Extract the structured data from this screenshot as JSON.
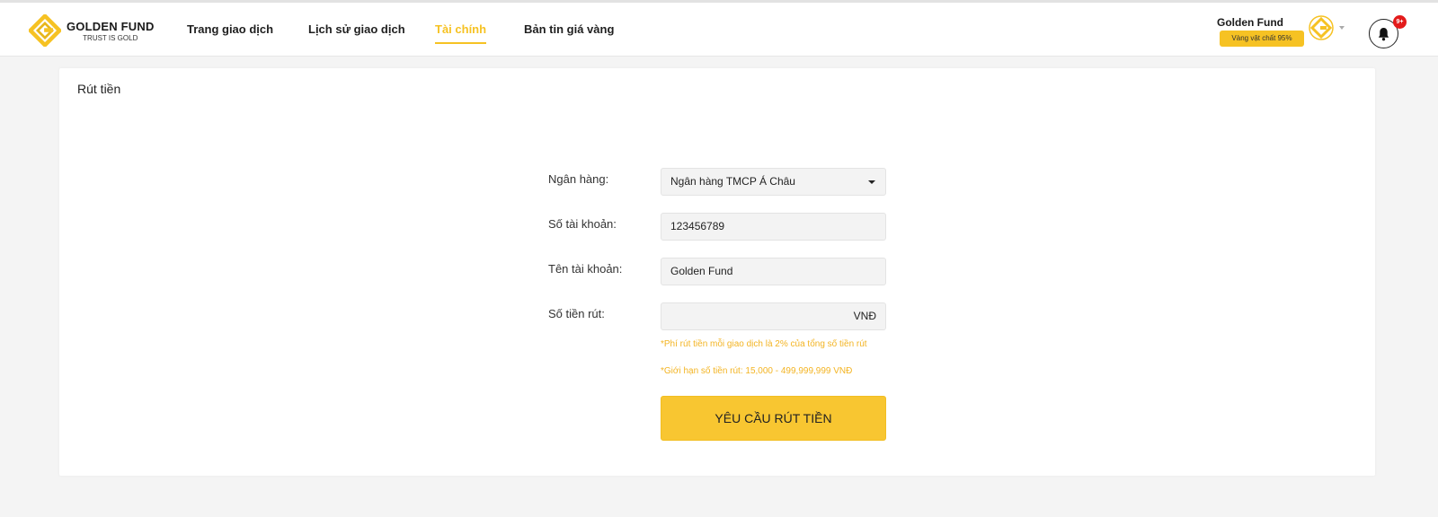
{
  "brand": {
    "name": "GOLDEN FUND",
    "tagline": "TRUST IS GOLD",
    "accent_color": "#f6c223",
    "logo_icon": "golden-fund-logo"
  },
  "nav": {
    "items": [
      {
        "label": "Trang giao dịch",
        "active": false
      },
      {
        "label": "Lịch sử giao dịch",
        "active": false
      },
      {
        "label": "Tài chính",
        "active": true
      },
      {
        "label": "Bản tin giá vàng",
        "active": false
      }
    ]
  },
  "user": {
    "name": "Golden Fund",
    "badge": "Vàng vật chất 95%",
    "notifications": "9+"
  },
  "page": {
    "title": "Rút tiền"
  },
  "form": {
    "bank_label": "Ngân hàng:",
    "bank_value": "Ngân hàng TMCP Á Châu",
    "account_number_label": "Số tài khoản:",
    "account_number_value": "123456789",
    "account_name_label": "Tên tài khoản:",
    "account_name_value": "Golden Fund",
    "amount_label": "Số tiền rút:",
    "amount_value": "",
    "amount_unit": "VNĐ",
    "note_fee": "*Phí rút tiền mỗi giao dịch là 2% của tổng số tiền rút",
    "note_limit": "*Giới hạn số tiền rút: 15,000 - 499,999,999 VNĐ",
    "submit_label": "YÊU CẦU RÚT TIỀN"
  }
}
